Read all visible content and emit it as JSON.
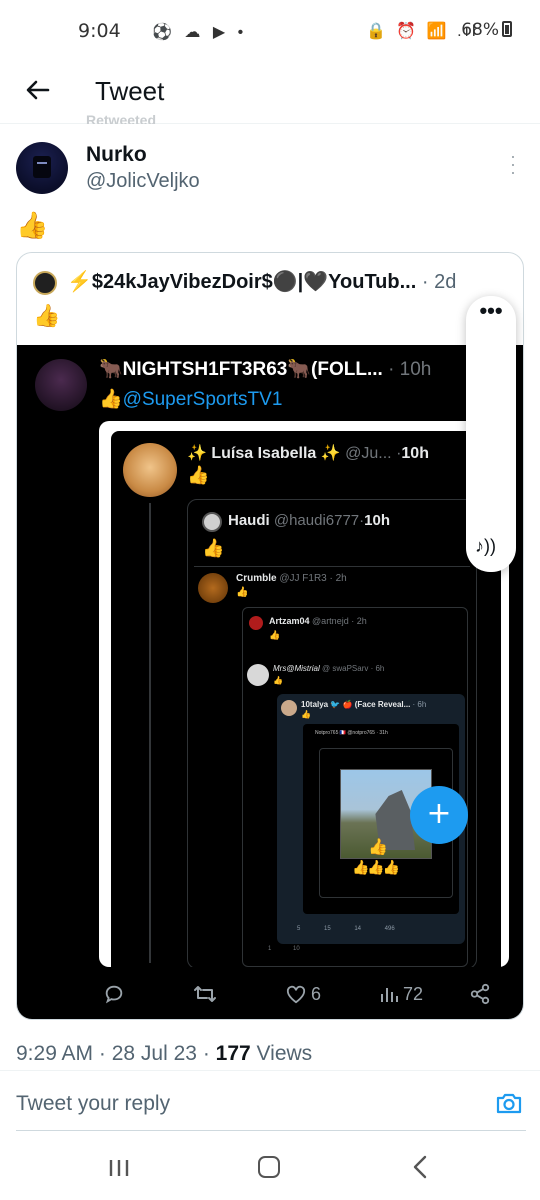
{
  "status_bar": {
    "time": "9:04",
    "left_icons": "⚽ ☁ ▶ •",
    "right_icons": "🔒 ⏰ 📶 .ıl",
    "battery": "68%"
  },
  "header": {
    "title": "Tweet",
    "ghost_text": "Retweeted"
  },
  "tweet": {
    "author_name": "Nurko",
    "author_handle": "@JolicVeljko",
    "text": "👍",
    "time": "9:29 AM",
    "date": "28 Jul 23",
    "views_count": "177",
    "views_label": "Views"
  },
  "quote": {
    "name": "⚡$24kJayVibezDoir$⚫|🖤YouTub...",
    "time": "2d",
    "text": "👍"
  },
  "media": {
    "top_name": "🐂NIGHTSH1FT3R63🐂(FOLL...",
    "top_time": "10h",
    "top_handle": "👍@SuperSportsTV1",
    "l1_name": "✨ Luísa Isabella ✨",
    "l1_handle": "@Ju...",
    "l1_time": "10h",
    "l1_text": "👍",
    "l2_name": "Haudi",
    "l2_handle": "@haudi6777",
    "l2_time": "10h",
    "l2_text": "👍",
    "l3_name": "Crumble",
    "l3_handle": "@JJ F1R3",
    "l3_time": "2h",
    "l3_text": "👍",
    "l4_name": "Artzam04",
    "l4_handle": "@artnejd",
    "l4_time": "2h",
    "l4_text": "👍",
    "l5_name": "Mrs@Mistrial",
    "l5_handle": "@ swaPSarv",
    "l5_time": "6h",
    "l5_text": "👍",
    "l6_name": "10talya 🐦 🍎 (Face Reveal...",
    "l6_time": "6h",
    "l6_text": "👍",
    "l7_text": "Notpro765 🇫🇷 @notpro765 · 31h",
    "mc_emoji1": "👍",
    "mc_emoji2": "👍👍👍",
    "l6_actions": "5 15 14 496",
    "l2_bottom": "1 10"
  },
  "actions": {
    "likes": "6",
    "views": "72"
  },
  "overlay": {
    "dots": "•••",
    "audio": "♪))"
  },
  "fab": {
    "label": "+"
  },
  "reply": {
    "placeholder": "Tweet your reply"
  },
  "colors": {
    "accent": "#1d9bf0",
    "text": "#0f1419",
    "secondary": "#536471"
  }
}
